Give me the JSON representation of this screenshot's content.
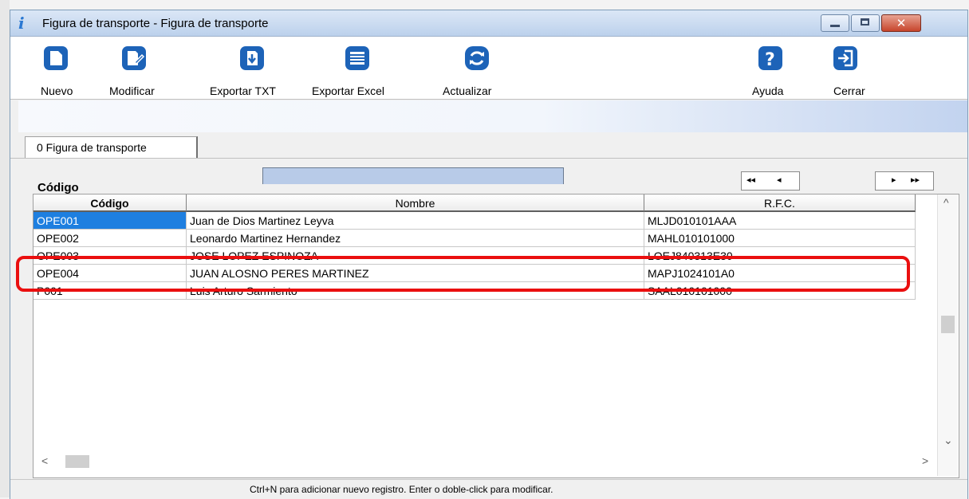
{
  "window": {
    "title": "Figura de transporte - Figura de transporte",
    "controls": {
      "minimize_icon": "minimize-icon",
      "maximize_icon": "maximize-icon",
      "close_icon": "close-icon",
      "close_glyph": "✕"
    }
  },
  "toolbar": {
    "nuevo": "Nuevo",
    "modificar": "Modificar",
    "exportar_txt": "Exportar TXT",
    "exportar_excel": "Exportar Excel",
    "actualizar": "Actualizar",
    "ayuda": "Ayuda",
    "cerrar": "Cerrar",
    "icon_color": "#1d63b8"
  },
  "tab": {
    "label": "0 Figura de transporte"
  },
  "filter": {
    "label": "Código",
    "value": "",
    "nav": {
      "first": "◂◂",
      "prev": "◂",
      "next": "▸",
      "last": "▸▸"
    }
  },
  "table": {
    "columns": [
      "Código",
      "Nombre",
      "R.F.C."
    ],
    "rows": [
      {
        "codigo": "OPE001",
        "nombre": "Juan de Dios Martinez Leyva",
        "rfc": "MLJD010101AAA"
      },
      {
        "codigo": "OPE002",
        "nombre": "Leonardo Martinez Hernandez",
        "rfc": "MAHL010101000"
      },
      {
        "codigo": "OPE003",
        "nombre": "JOSE LOPEZ ESPINOZA",
        "rfc": "LOEJ840313E30"
      },
      {
        "codigo": "OPE004",
        "nombre": "JUAN ALOSNO PERES MARTINEZ",
        "rfc": "MAPJ1024101A0"
      },
      {
        "codigo": "P001",
        "nombre": "Luis Arturo Sarmiento",
        "rfc": "SAAL010101000"
      }
    ],
    "selected_row": 0,
    "highlighted_row": 3,
    "highlight_color": "#ea0f0f",
    "scroll": {
      "up": "^",
      "down": "⌄",
      "left": "<",
      "right": ">"
    }
  },
  "status": "Ctrl+N para adicionar nuevo registro. Enter o doble-click para modificar."
}
